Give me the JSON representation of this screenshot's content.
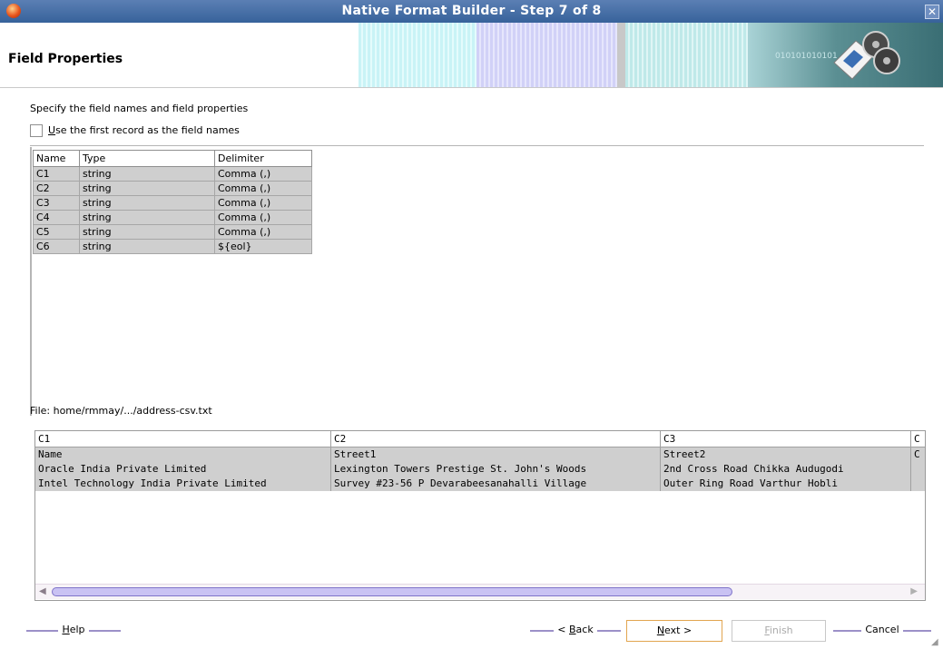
{
  "window": {
    "title": "Native Format Builder - Step 7 of 8",
    "close_glyph": "✕"
  },
  "header": {
    "heading": "Field Properties",
    "decoration_text": "010101010101"
  },
  "instructions": "Specify the field names and field properties",
  "first_record_checkbox": {
    "mnemonic": "U",
    "label_rest": "se the first record as the field names",
    "checked": false
  },
  "field_table": {
    "headers": [
      "Name",
      "Type",
      "Delimiter"
    ],
    "rows": [
      {
        "name": "C1",
        "type": "string",
        "delimiter": "Comma (,)"
      },
      {
        "name": "C2",
        "type": "string",
        "delimiter": "Comma (,)"
      },
      {
        "name": "C3",
        "type": "string",
        "delimiter": "Comma (,)"
      },
      {
        "name": "C4",
        "type": "string",
        "delimiter": "Comma (,)"
      },
      {
        "name": "C5",
        "type": "string",
        "delimiter": "Comma (,)"
      },
      {
        "name": "C6",
        "type": "string",
        "delimiter": "${eol}"
      }
    ]
  },
  "file_label": "File: home/rmmay/.../address-csv.txt",
  "preview": {
    "columns": [
      {
        "header": "C1",
        "cells": [
          "Name",
          "Oracle India Private Limited",
          "Intel Technology India Private Limited"
        ]
      },
      {
        "header": "C2",
        "cells": [
          "Street1",
          " Lexington Towers Prestige St. John's Woods",
          " Survey #23-56 P Devarabeesanahalli Village"
        ]
      },
      {
        "header": "C3",
        "cells": [
          "Street2",
          " 2nd Cross Road Chikka Audugodi",
          " Outer Ring Road Varthur Hobli"
        ]
      },
      {
        "header": "C",
        "cells": [
          "C",
          "",
          ""
        ]
      }
    ],
    "scroll_left": "◀",
    "scroll_right": "▶"
  },
  "buttons": {
    "help": {
      "mnemonic": "H",
      "rest": "elp"
    },
    "back": {
      "prefix": "< ",
      "mnemonic": "B",
      "rest": "ack"
    },
    "next": {
      "mnemonic": "N",
      "rest": "ext >"
    },
    "finish": {
      "mnemonic": "F",
      "rest": "inish"
    },
    "cancel": "Cancel"
  },
  "colors": {
    "titlebar": "#37629b",
    "row_bg": "#cfcfcf",
    "scroll_thumb": "#c9c2f3",
    "next_border": "#e2a550"
  }
}
